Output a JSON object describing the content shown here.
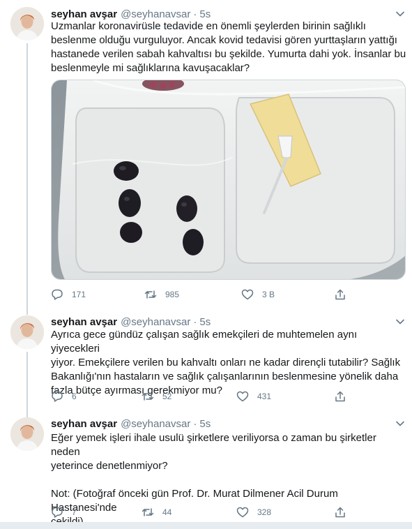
{
  "tweets": [
    {
      "name": "seyhan avşar",
      "handle": "@seyhanavsar",
      "dot": "·",
      "time": "5s",
      "text": [
        "Uzmanlar koronavirüsle tedavide en önemli şeylerden birinin sağlıklı",
        "beslenme olduğu vurguluyor. Ancak kovid tedavisi gören yurttaşların yattığı",
        "hastanede verilen sabah kahvaltısı bu şekilde. Yumurta dahi yok. İnsanlar bu",
        "beslenmeyle mi sağlıklarına kavuşacaklar?"
      ],
      "replies": "171",
      "retweets": "985",
      "likes": "3 B"
    },
    {
      "name": "seyhan avşar",
      "handle": "@seyhanavsar",
      "dot": "·",
      "time": "5s",
      "text": [
        "Ayrıca gece gündüz çalışan sağlık emekçileri de muhtemelen aynı yiyecekleri",
        "yiyor. Emekçilere verilen bu kahvaltı onları ne kadar dirençli tutabilir? Sağlık",
        "Bakanlığı'nın hastaların  ve sağlık çalışanlarının beslenmesine yönelik daha",
        "fazla bütçe ayırması gerekmiyor mu?"
      ],
      "replies": "6",
      "retweets": "52",
      "likes": "431"
    },
    {
      "name": "seyhan avşar",
      "handle": "@seyhanavsar",
      "dot": "·",
      "time": "5s",
      "text": [
        "Eğer yemek işleri ihale usulü şirketlere veriliyorsa o zaman bu şirketler neden",
        "yeterince denetlenmiyor?",
        "",
        "Not: (Fotoğraf önceki gün Prof. Dr. Murat Dilmener Acil Durum Hastanesi'nde",
        "çekildi)"
      ],
      "replies": "7",
      "retweets": "44",
      "likes": "328"
    }
  ],
  "icons": {
    "reply": "reply-icon",
    "retweet": "retweet-icon",
    "like": "heart-icon",
    "share": "share-icon",
    "more": "chevron-down-icon"
  },
  "colors": {
    "icon": "#657786",
    "thread_line": "#ccd6dd",
    "divider": "#e6ecf0"
  }
}
